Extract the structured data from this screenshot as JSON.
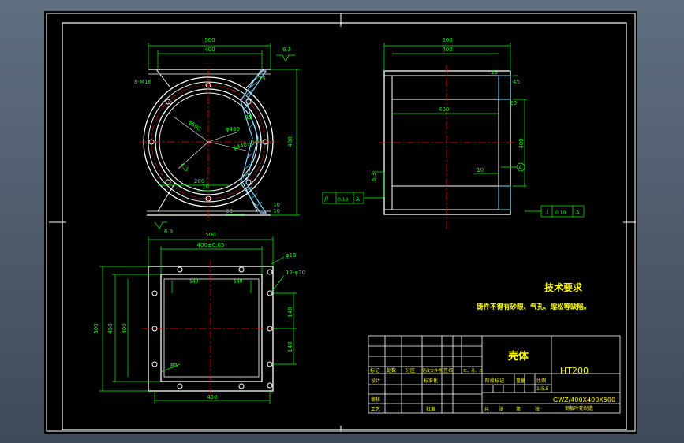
{
  "drawing": {
    "colors": {
      "background": "#000000",
      "frame": "#ffffff",
      "dimension": "#00ff00",
      "centerline": "#ff0000",
      "hatch": "#7ad7ff",
      "text": "#ffff00",
      "titleblock_text": "#ffff00"
    },
    "front_view": {
      "dim_top_outer": "500",
      "dim_top_inner": "400",
      "surface_finish": "6.3",
      "hole_note": "8-M16",
      "angle_note": "15",
      "dia_outer": "φ500",
      "dia_mid": "φ460",
      "dia_pitch": "φ440±0.1",
      "dim_right": "400",
      "finish_left": "6.3",
      "dim_bottom_a": "280",
      "dim_bottom_b": "10",
      "dim_bottom_c": "30",
      "dim_bottom_d": "10",
      "dim_bottom_e": "10",
      "finish_bottom": "6.3",
      "dim_angle_15": "15"
    },
    "side_view": {
      "dim_top": "500",
      "dim_top_inner": "400",
      "dim_15": "15",
      "dim_20": "20",
      "dim_45": "45",
      "dim_400": "400",
      "dim_10": "10",
      "dim_right": "400",
      "datum": "A",
      "finish": "6.3",
      "tol_left_sym": "//",
      "tol_left_val": "0.10",
      "tol_left_datum": "A",
      "tol_right_sym": "⊥",
      "tol_right_val": "0.10",
      "tol_right_datum": "A"
    },
    "bottom_view": {
      "dim_top": "500",
      "dim_top_inner": "400±0.05",
      "dim_410": "φ10",
      "hole_note": "12-φ30",
      "inner_top_left": "140",
      "inner_top_right": "140",
      "right_140_a": "140",
      "right_140_b": "140",
      "left_500": "500",
      "left_450": "450",
      "left_400": "400",
      "r_note": "R5",
      "dim_bottom": "450"
    },
    "tech": {
      "title": "技术要求",
      "line1": "铸件不得有砂眼、气孔、缩松等缺陷。"
    },
    "title_block": {
      "part_name": "壳体",
      "material": "HT200",
      "drawing_no": "GWZ/400X400X500",
      "subtitle": "钢板叶轮制造",
      "scale": "1:5.5",
      "row_labels": [
        "标记",
        "处数",
        "分区",
        "更改文件号",
        "签名",
        "年、月、日"
      ],
      "design": "设计",
      "standard": "标准化",
      "stage_header": [
        "阶段标记",
        "重量",
        "比例"
      ],
      "check": "审核",
      "process": "工艺",
      "approve": "批准",
      "sheets": [
        "共",
        "张",
        "第",
        "张"
      ]
    }
  }
}
